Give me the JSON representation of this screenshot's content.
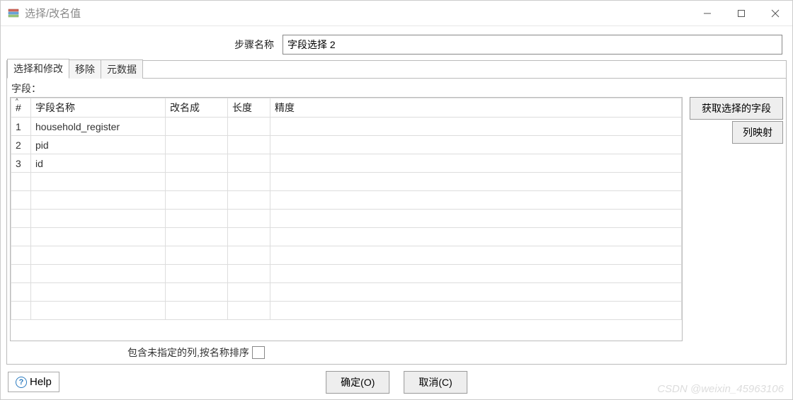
{
  "window": {
    "title": "选择/改名值"
  },
  "step": {
    "label": "步骤名称",
    "value": "字段选择 2"
  },
  "tabs": [
    {
      "label": "选择和修改",
      "active": true
    },
    {
      "label": "移除",
      "active": false
    },
    {
      "label": "元数据",
      "active": false
    }
  ],
  "fields_caption": "字段：",
  "columns": {
    "idx": "#",
    "name": "字段名称",
    "rename": "改名成",
    "length": "长度",
    "precision": "精度"
  },
  "rows": [
    {
      "n": "1",
      "name": "household_register",
      "rename": "",
      "length": "",
      "precision": ""
    },
    {
      "n": "2",
      "name": "pid",
      "rename": "",
      "length": "",
      "precision": ""
    },
    {
      "n": "3",
      "name": "id",
      "rename": "",
      "length": "",
      "precision": ""
    }
  ],
  "side": {
    "get_fields": "获取选择的字段",
    "col_mapping": "列映射"
  },
  "include_unspecified": "包含未指定的列,按名称排序",
  "footer": {
    "help": "Help",
    "ok": "确定(O)",
    "cancel": "取消(C)"
  },
  "watermark": "CSDN @weixin_45963106"
}
